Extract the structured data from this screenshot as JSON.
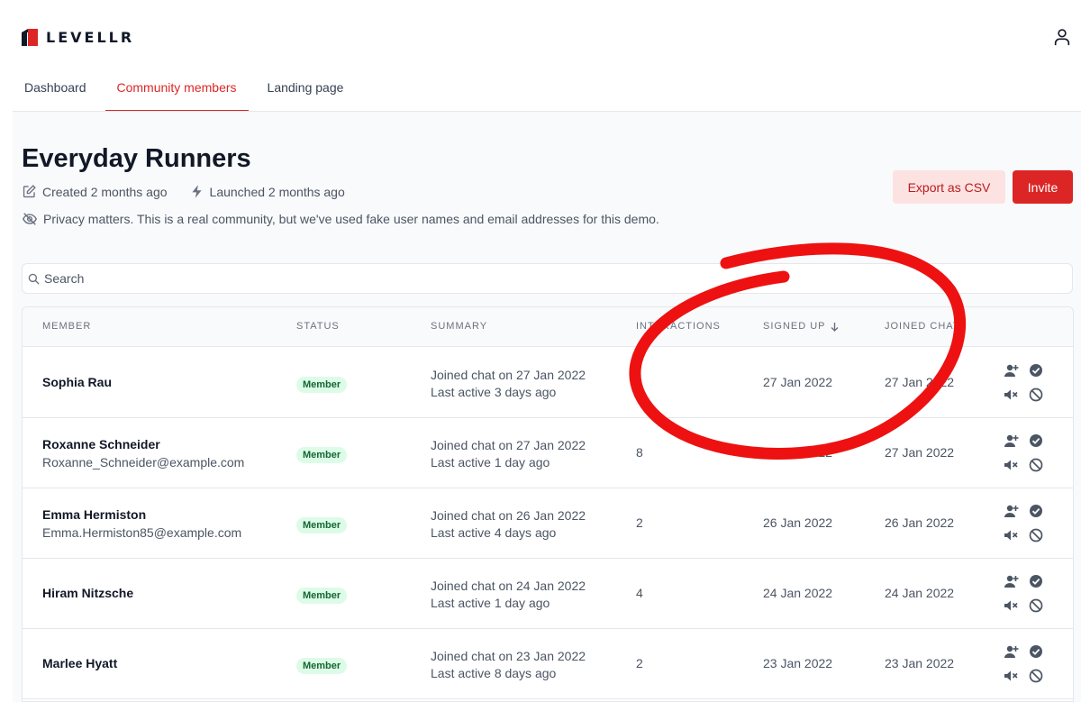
{
  "brand": {
    "name": "LEVELLR",
    "accent": "#dc2626"
  },
  "nav": {
    "tabs": [
      {
        "label": "Dashboard"
      },
      {
        "label": "Community members"
      },
      {
        "label": "Landing page"
      }
    ],
    "active_tab": "Community members"
  },
  "header": {
    "title": "Everyday Runners",
    "created": "Created 2 months ago",
    "launched": "Launched 2 months ago",
    "privacy": "Privacy matters. This is a real community, but we've used fake user names and email addresses for this demo.",
    "export_label": "Export as CSV",
    "invite_label": "Invite"
  },
  "search": {
    "placeholder": "Search",
    "value": ""
  },
  "table": {
    "columns": {
      "member": "MEMBER",
      "status": "STATUS",
      "summary": "SUMMARY",
      "interactions": "INTERACTIONS",
      "signed_up": "SIGNED UP",
      "joined_chat": "JOINED CHAT"
    },
    "sort": {
      "column": "signed_up",
      "direction": "desc"
    },
    "rows": [
      {
        "name": "Sophia Rau",
        "email": "",
        "status": "Member",
        "summary1": "Joined chat on 27 Jan 2022",
        "summary2": "Last active 3 days ago",
        "interactions": "",
        "signed_up": "27 Jan 2022",
        "joined_chat": "27 Jan 2022"
      },
      {
        "name": "Roxanne Schneider",
        "email": "Roxanne_Schneider@example.com",
        "status": "Member",
        "summary1": "Joined chat on 27 Jan 2022",
        "summary2": "Last active 1 day ago",
        "interactions": "8",
        "signed_up": "27 Jan 2022",
        "joined_chat": "27 Jan 2022"
      },
      {
        "name": "Emma Hermiston",
        "email": "Emma.Hermiston85@example.com",
        "status": "Member",
        "summary1": "Joined chat on 26 Jan 2022",
        "summary2": "Last active 4 days ago",
        "interactions": "2",
        "signed_up": "26 Jan 2022",
        "joined_chat": "26 Jan 2022"
      },
      {
        "name": "Hiram Nitzsche",
        "email": "",
        "status": "Member",
        "summary1": "Joined chat on 24 Jan 2022",
        "summary2": "Last active 1 day ago",
        "interactions": "4",
        "signed_up": "24 Jan 2022",
        "joined_chat": "24 Jan 2022"
      },
      {
        "name": "Marlee Hyatt",
        "email": "",
        "status": "Member",
        "summary1": "Joined chat on 23 Jan 2022",
        "summary2": "Last active 8 days ago",
        "interactions": "2",
        "signed_up": "23 Jan 2022",
        "joined_chat": "23 Jan 2022"
      }
    ],
    "row_actions": [
      "promote-user-icon",
      "approve-icon",
      "mute-icon",
      "ban-icon"
    ]
  },
  "annotation": {
    "shape": "hand-drawn circle",
    "color": "#ee1111"
  }
}
